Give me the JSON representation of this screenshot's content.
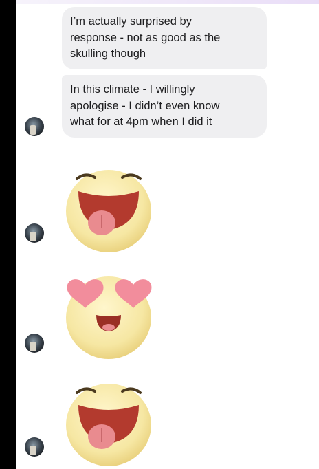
{
  "conversation": {
    "messages": [
      {
        "type": "text",
        "lines": [
          "I’m actually surprised by",
          "response - not as good as the",
          "skulling though"
        ]
      },
      {
        "type": "text",
        "lines": [
          "In this climate - I willingly",
          "apologise - I didn’t even know",
          "what for at 4pm when I did it"
        ]
      },
      {
        "type": "emoji",
        "icon": "tongue-out-emoji-icon"
      },
      {
        "type": "emoji",
        "icon": "heart-eyes-emoji-icon"
      },
      {
        "type": "emoji",
        "icon": "tongue-out-emoji-icon"
      }
    ]
  },
  "colors": {
    "bubble_background": "#efeff1",
    "text": "#1d1d1f",
    "emoji_face": "#f6e7a3",
    "heart": "#f28d9c"
  }
}
